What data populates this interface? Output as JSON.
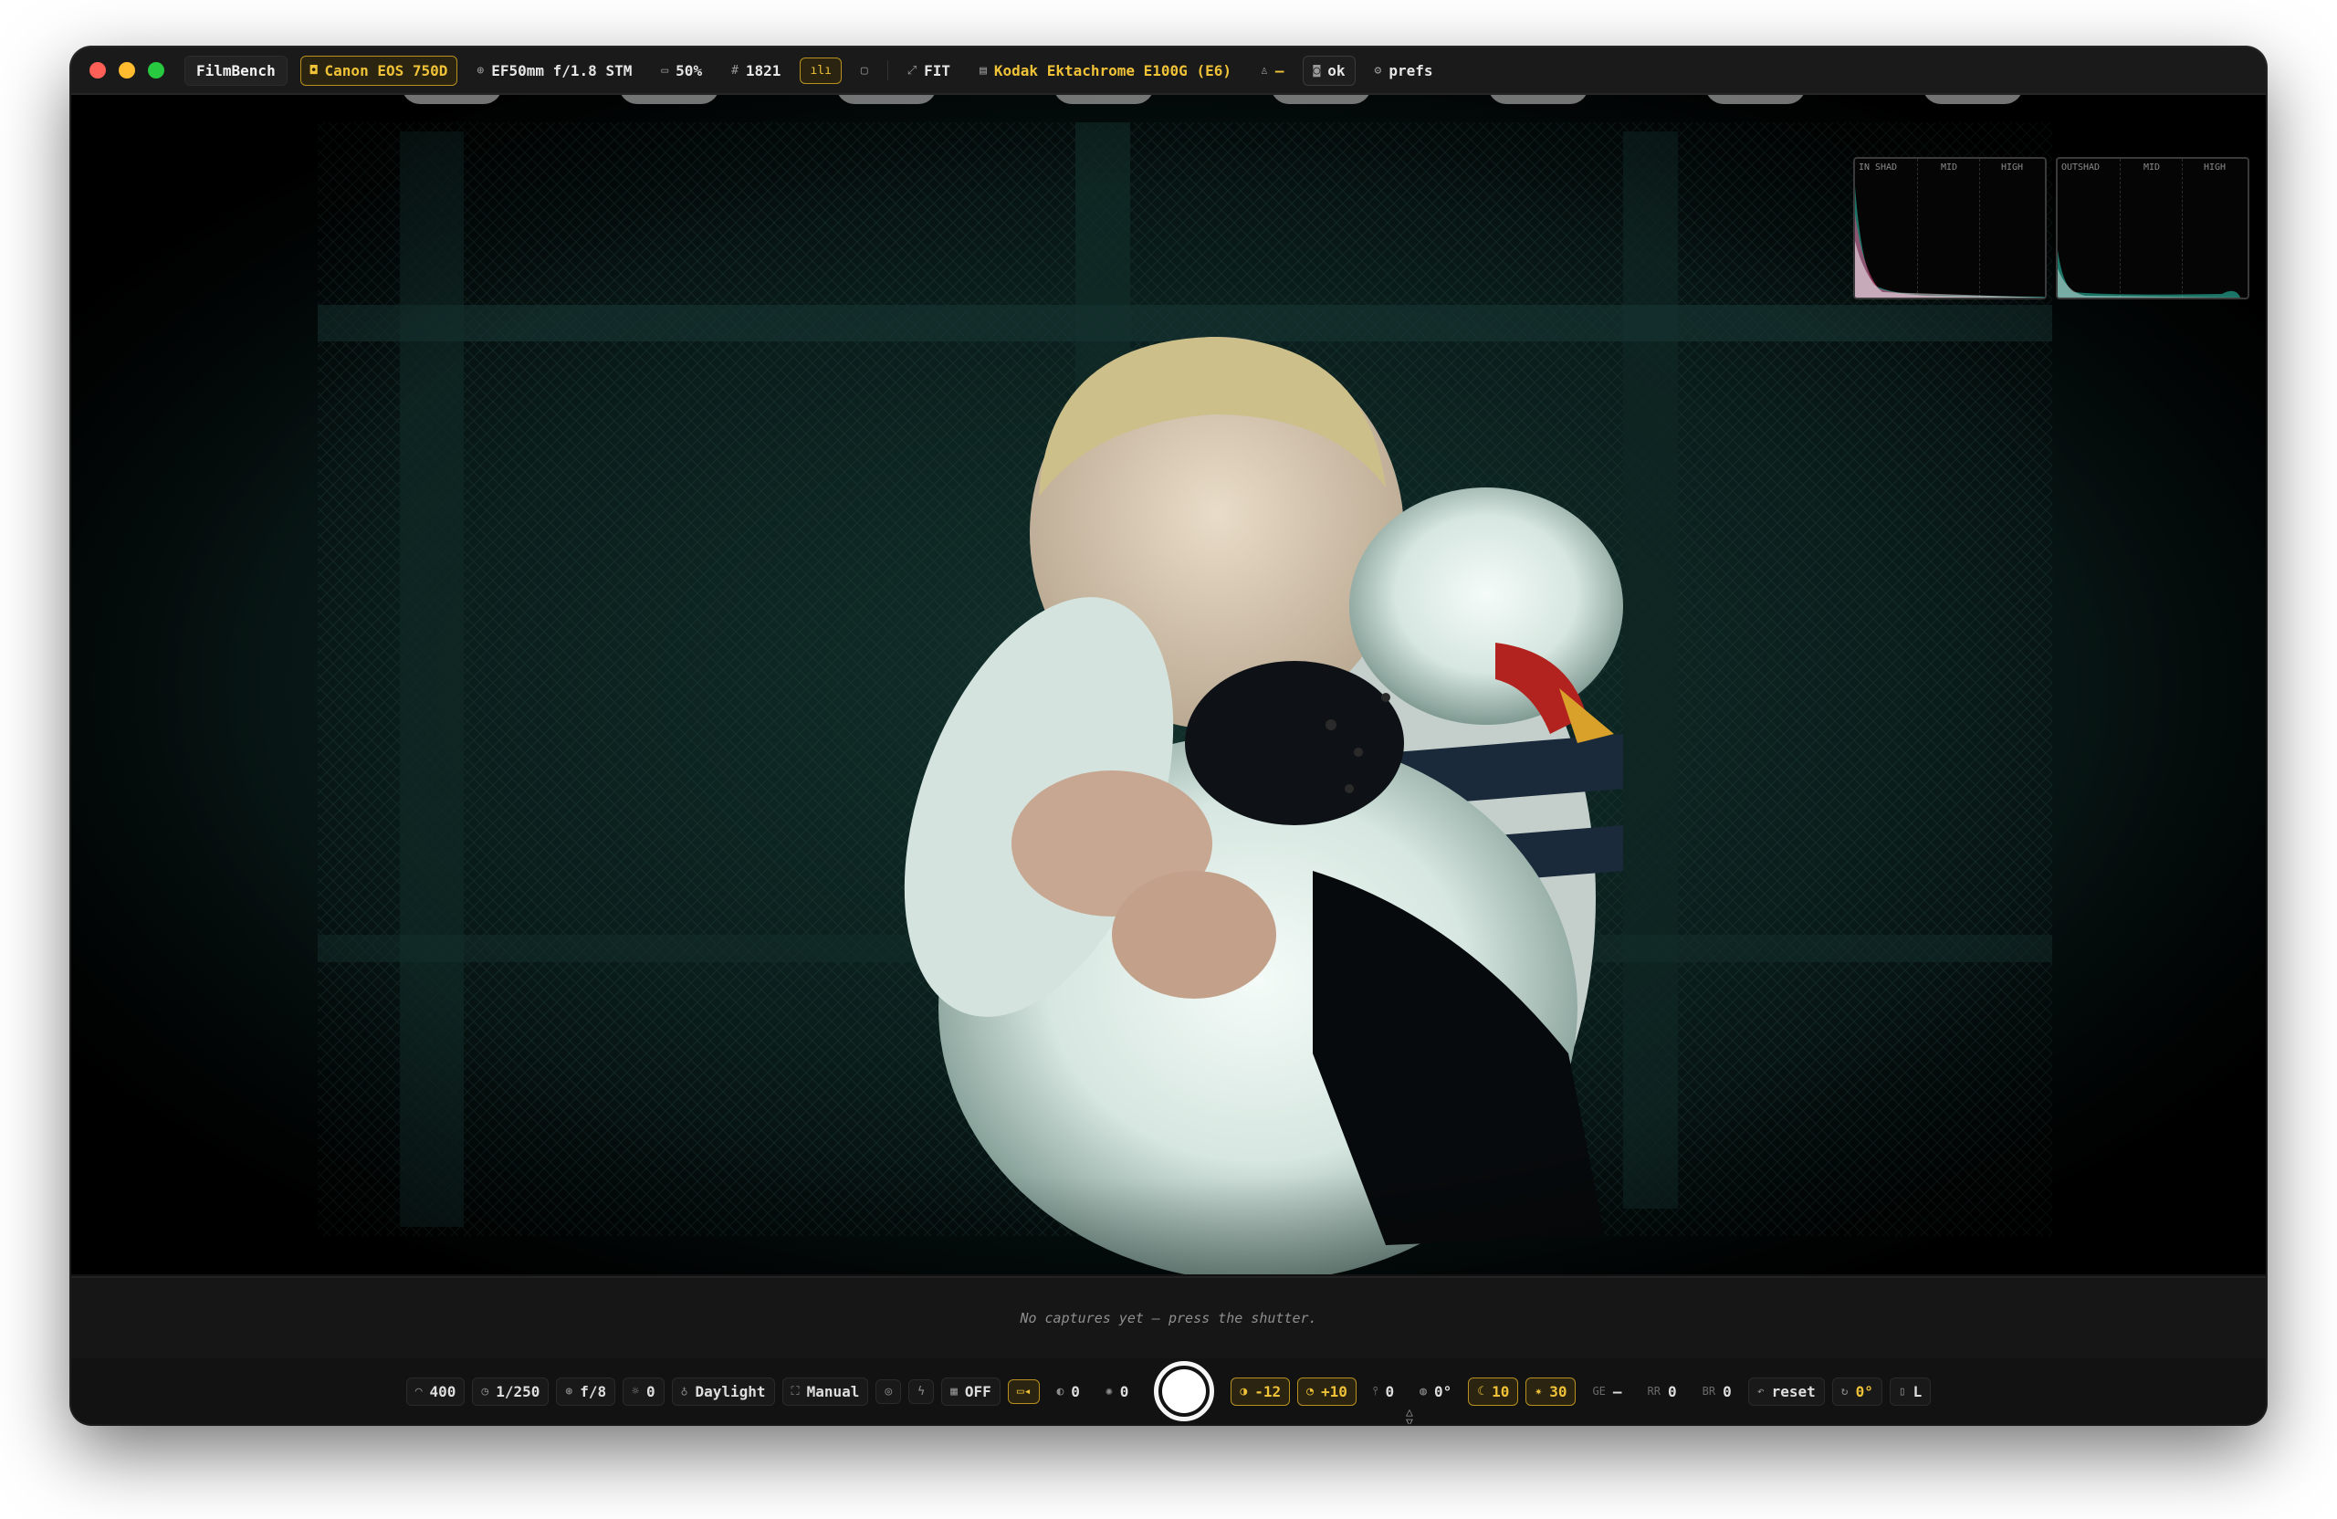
{
  "app": {
    "name": "FilmBench"
  },
  "toolbar": {
    "camera": "Canon EOS 750D",
    "lens": "EF50mm f/1.8 STM",
    "zoom": "50%",
    "frame": "1821",
    "fit": "FIT",
    "film": "Kodak Ektachrome E100G (E6)",
    "user": "—",
    "status": "ok",
    "prefs": "prefs"
  },
  "histograms": [
    {
      "tag": "IN",
      "labels": [
        "SHAD",
        "MID",
        "HIGH"
      ]
    },
    {
      "tag": "OUT",
      "labels": [
        "SHAD",
        "MID",
        "HIGH"
      ]
    }
  ],
  "strip": {
    "message": "No captures yet — press the shutter."
  },
  "controls": {
    "iso": "400",
    "shutter_speed": "1/250",
    "aperture": "f/8",
    "ev": "0",
    "white_balance": "Daylight",
    "focus_mode": "Manual",
    "grid": "OFF",
    "contrast": "0",
    "brightness": "0",
    "exposure_shift": "-12",
    "tint": "+10",
    "temperature": "0",
    "hue": "0°",
    "vignette": "10",
    "grain": "30",
    "ge_label": "GE",
    "ge_value": "—",
    "rr_label": "RR",
    "rr_value": "0",
    "br_label": "BR",
    "br_value": "0",
    "reset": "reset",
    "rotation": "0°",
    "size": "L"
  },
  "colors": {
    "accent": "#f0c238",
    "background": "#121212"
  }
}
